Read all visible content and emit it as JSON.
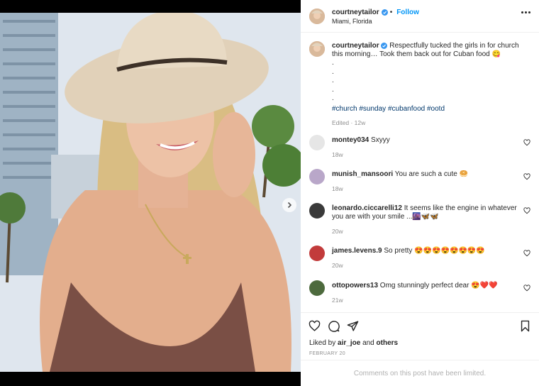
{
  "post": {
    "username": "courtneytailor",
    "follow_label": "Follow",
    "separator": "•",
    "location": "Miami, Florida",
    "caption_text": "Respectfully tucked the girls in for church this morning… Took them back out for Cuban food 😋",
    "caption_dots": [
      ".",
      ".",
      ".",
      ".",
      "."
    ],
    "hashtags": "#church #sunday #cubanfood #ootd",
    "edited_meta": "Edited · 12w",
    "likes_prefix": "Liked by",
    "likes_user": "air_joe",
    "likes_and": "and",
    "likes_others": "others",
    "date": "FEBRUARY 20",
    "comments_limited": "Comments on this post have been limited."
  },
  "comments": [
    {
      "user": "montey034",
      "text": "Sxyyy",
      "time": "18w",
      "avatar_color": "#e6e6e6"
    },
    {
      "user": "munish_mansoori",
      "text": "You are such a cute 🥯",
      "time": "18w",
      "avatar_color": "#b9a7c9"
    },
    {
      "user": "leonardo.ciccarelli12",
      "text": "It seems like the engine in whatever you are with your smile ...🌆🦋🦋",
      "time": "20w",
      "avatar_color": "#3a3a3a"
    },
    {
      "user": "james.levens.9",
      "text": "So pretty 😍😍😍😍😍😍😍😍",
      "time": "20w",
      "avatar_color": "#c23b3b"
    },
    {
      "user": "ottopowers13",
      "text": "Omg stunningly perfect dear 😍❤️❤️",
      "time": "21w",
      "avatar_color": "#4d6a3d"
    }
  ],
  "icons": {
    "more": "more-options-icon",
    "like": "heart-icon",
    "comment": "comment-icon",
    "share": "share-icon",
    "save": "bookmark-icon",
    "verified": "verified-badge-icon",
    "next": "chevron-right-icon"
  },
  "colors": {
    "accent": "#0095f6",
    "hashtag": "#00376b",
    "muted": "#8e8e8e",
    "verified": "#3897f0"
  },
  "carousel": {
    "count": 3,
    "active_index": 1
  }
}
